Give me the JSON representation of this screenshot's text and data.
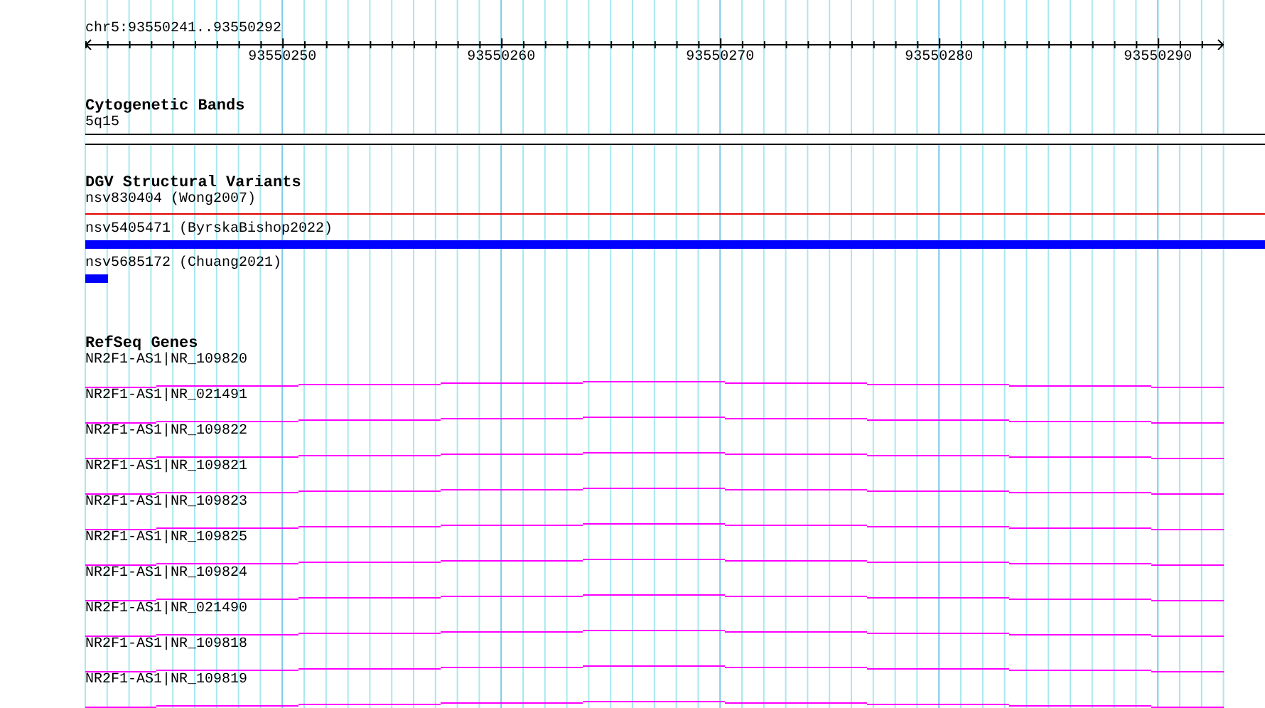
{
  "location": "chr5:93550241..93550292",
  "ruler_labels": [
    "93550250",
    "93550260",
    "93550270",
    "93550280",
    "93550290"
  ],
  "tracks": [
    {
      "kind": "bands",
      "title": "Cytogenetic Bands",
      "features": [
        {
          "label": "5q15"
        }
      ]
    },
    {
      "kind": "variants",
      "title": "DGV Structural Variants",
      "features": [
        {
          "label": "nsv830404 (Wong2007)",
          "kind": "line",
          "color": "#e00000"
        },
        {
          "label": "nsv5405471 (ByrskaBishop2022)",
          "kind": "bar",
          "color": "#0000ff"
        },
        {
          "label": "nsv5685172 (Chuang2021)",
          "kind": "stub",
          "color": "#0000ff"
        }
      ]
    },
    {
      "kind": "genes",
      "title": "RefSeq Genes",
      "features": [
        {
          "label": "NR2F1-AS1|NR_109820"
        },
        {
          "label": "NR2F1-AS1|NR_021491"
        },
        {
          "label": "NR2F1-AS1|NR_109822"
        },
        {
          "label": "NR2F1-AS1|NR_109821"
        },
        {
          "label": "NR2F1-AS1|NR_109823"
        },
        {
          "label": "NR2F1-AS1|NR_109825"
        },
        {
          "label": "NR2F1-AS1|NR_109824"
        },
        {
          "label": "NR2F1-AS1|NR_021490"
        },
        {
          "label": "NR2F1-AS1|NR_109818"
        },
        {
          "label": "NR2F1-AS1|NR_109819"
        }
      ]
    }
  ]
}
